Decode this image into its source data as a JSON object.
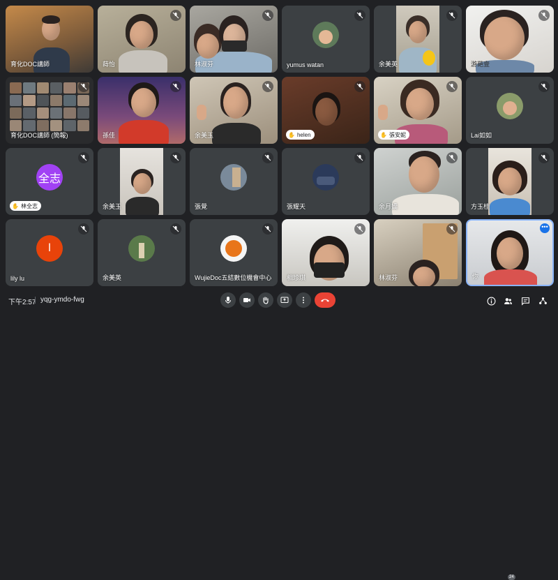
{
  "participants": [
    {
      "name": "育化DOC講師"
    },
    {
      "name": "蒔怡"
    },
    {
      "name": "林淑芬"
    },
    {
      "name": "yumus watan"
    },
    {
      "name": "余美英"
    },
    {
      "name": "游葩壹"
    },
    {
      "name": "育化DOC講師 (簡報)"
    },
    {
      "name": "孫佳"
    },
    {
      "name": "余美玉"
    },
    {
      "name": "helen"
    },
    {
      "name": "張安妮"
    },
    {
      "name": "Lai如如"
    },
    {
      "name": "林全志",
      "avatar_text": "全志",
      "avatar_color": "#a142f4"
    },
    {
      "name": "余美玉"
    },
    {
      "name": "張覺"
    },
    {
      "name": "張耀天"
    },
    {
      "name": "余月嬌"
    },
    {
      "name": "方玉桂"
    },
    {
      "name": "lily lu",
      "avatar_text": "l",
      "avatar_color": "#e8430a"
    },
    {
      "name": "余美英"
    },
    {
      "name": "WujieDoc五結數位機會中心"
    },
    {
      "name": "相珍琪"
    },
    {
      "name": "林淑芬"
    },
    {
      "name": "你"
    }
  ],
  "bottom_bar": {
    "time": "下午2:57",
    "meeting_code": "yqg-ymdo-fwg",
    "people_count": "24",
    "more_dots": "•••"
  },
  "icons": {
    "mic": "microphone-icon",
    "camera": "camera-icon",
    "hand": "raise-hand-icon",
    "present": "present-screen-icon",
    "more": "more-vert-icon",
    "end": "end-call-icon",
    "info": "info-icon",
    "people": "people-icon",
    "chat": "chat-icon",
    "activities": "activities-icon"
  },
  "colors": {
    "background": "#202124",
    "tile": "#3c4043",
    "end_call": "#ea4335",
    "self_border": "#8ab4f8"
  }
}
